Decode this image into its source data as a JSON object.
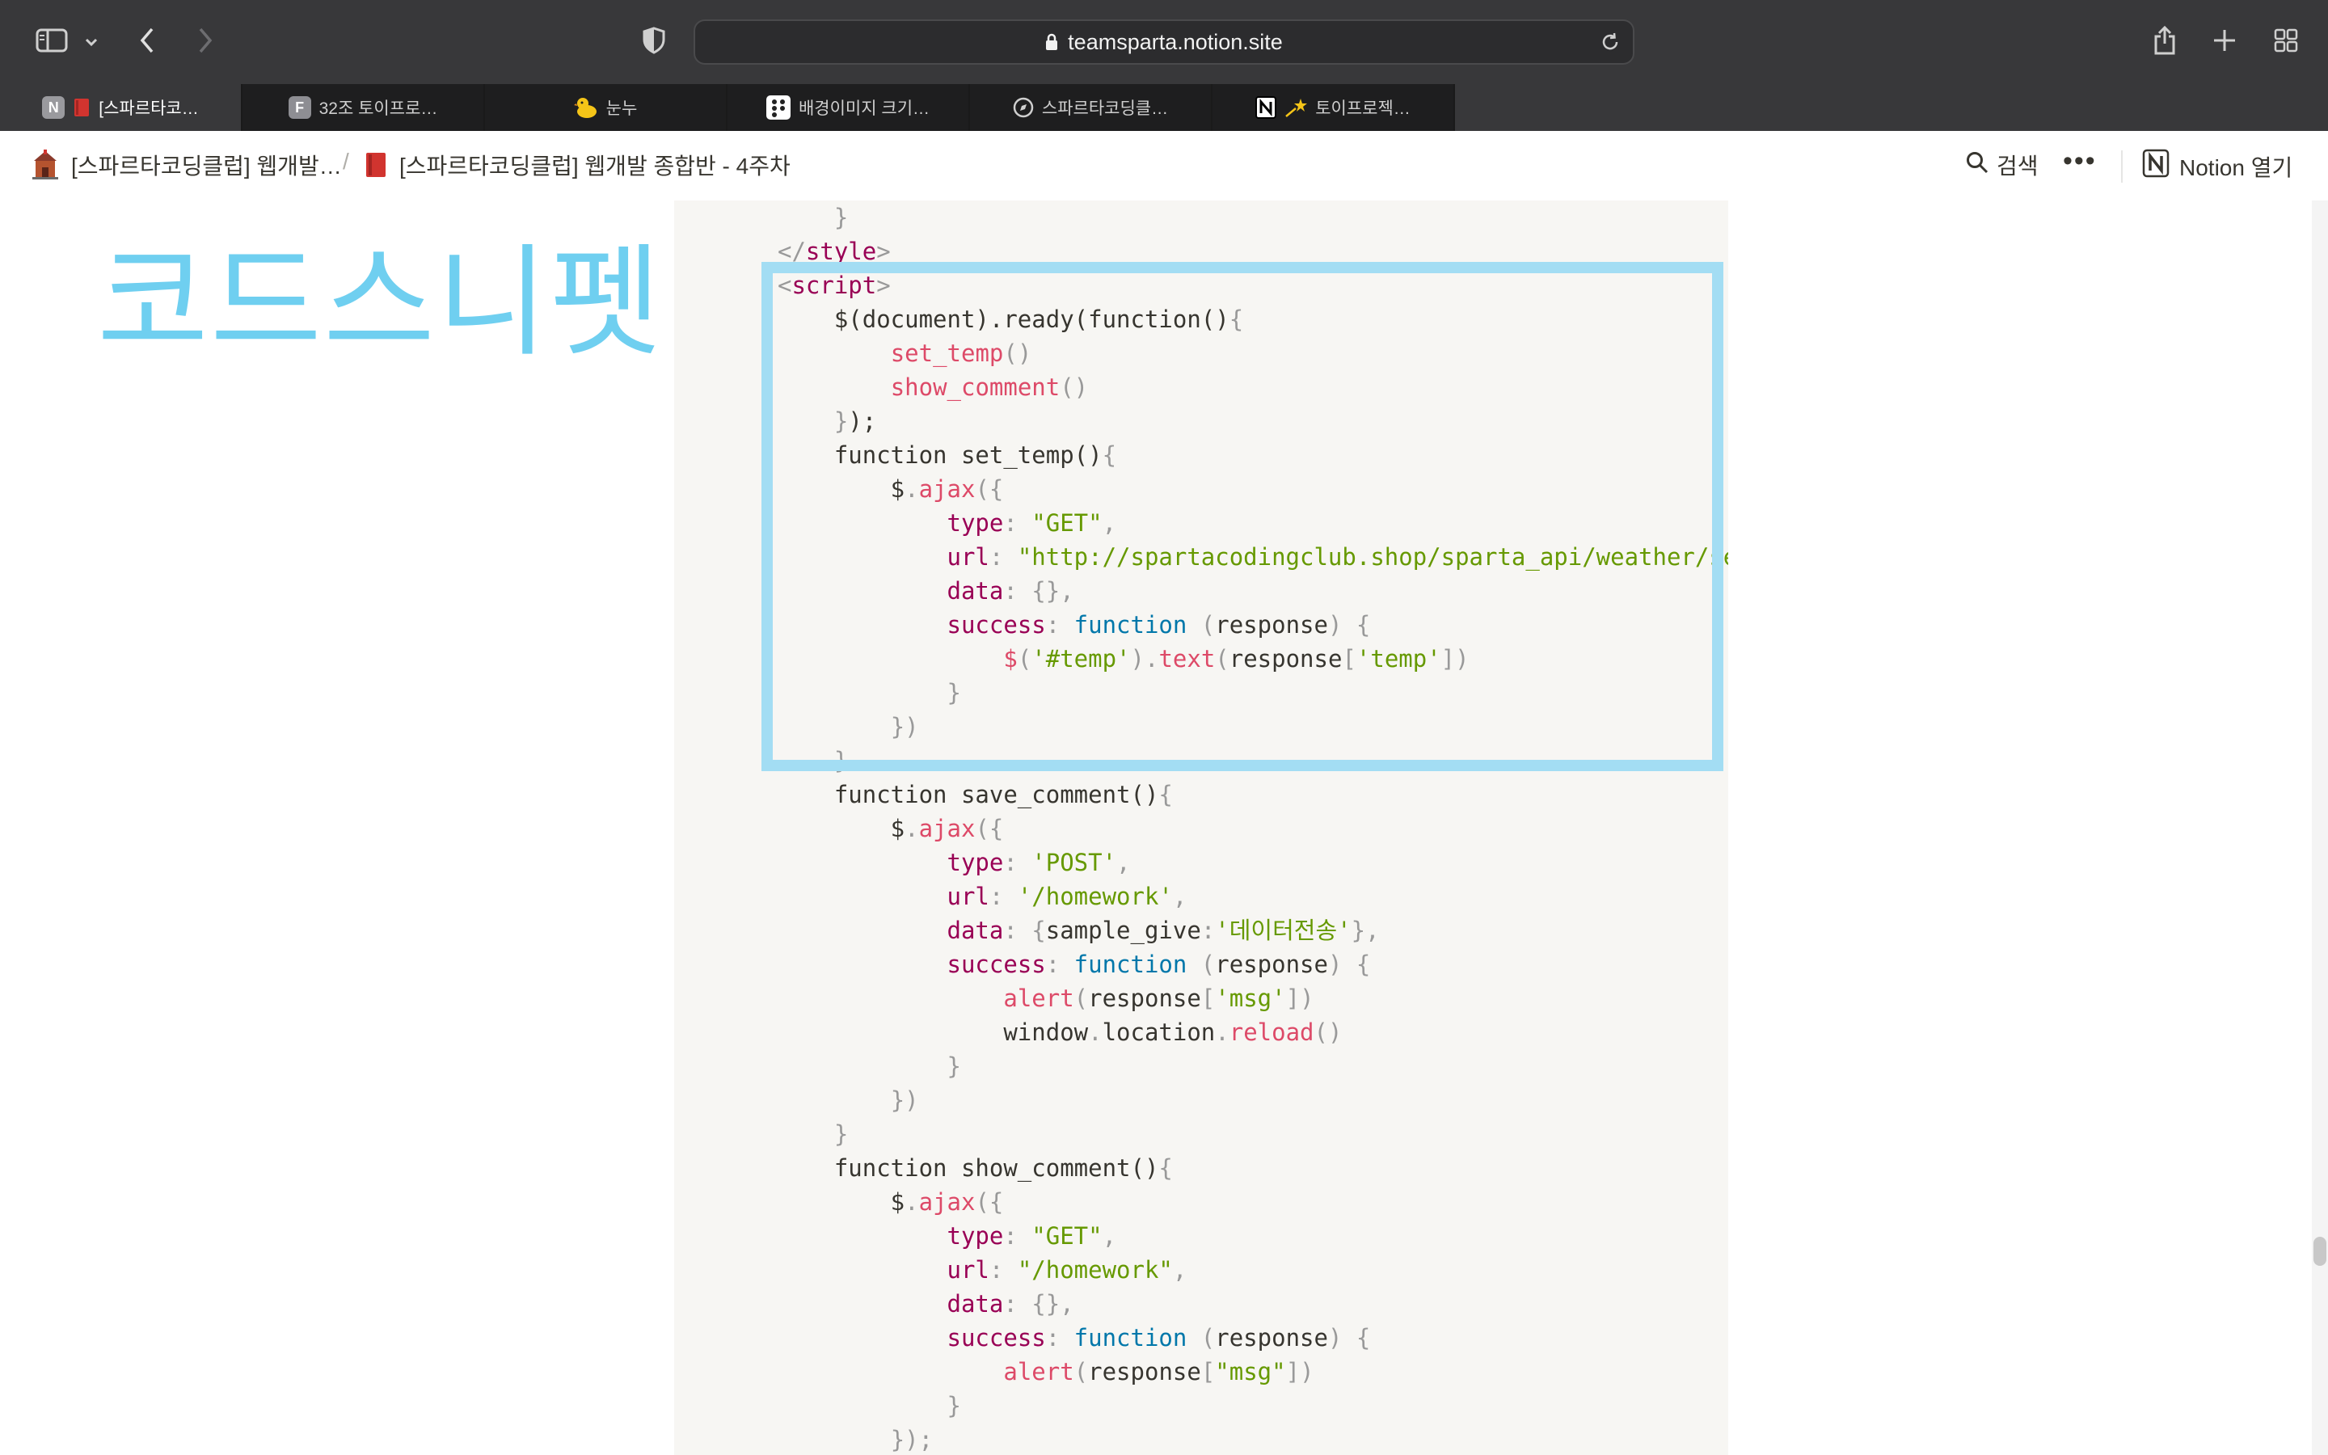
{
  "browser": {
    "url": "teamsparta.notion.site",
    "tabs": [
      {
        "label": "[스파르타코…",
        "fav": "N",
        "active": true
      },
      {
        "label": "32조 토이프로…",
        "fav": "F",
        "active": false
      },
      {
        "label": "눈누",
        "fav": "duck",
        "active": false
      },
      {
        "label": "배경이미지 크기…",
        "fav": "dots",
        "active": false
      },
      {
        "label": "스파르타코딩클…",
        "fav": "compass",
        "active": false
      },
      {
        "label": "토이프로젝…",
        "fav": "notion",
        "active": false
      }
    ]
  },
  "notion": {
    "breadcrumb_1": "[스파르타코딩클럽] 웹개발…",
    "breadcrumb_sep": "/",
    "breadcrumb_2": "[스파르타코딩클럽] 웹개발 종합반 - 4주차",
    "search_label": "검색",
    "more_label": "•••",
    "open_label": "Notion 열기"
  },
  "content": {
    "snippet_title": "코드스니펫"
  },
  "colors": {
    "highlight": "#a3ddf3",
    "title": "#6fcff0",
    "code_bg": "#f7f6f3"
  },
  "code_lines": [
    [
      [
        "    ",
        "plain"
      ],
      [
        "}",
        "punc"
      ]
    ],
    [
      [
        "</",
        "punc"
      ],
      [
        "style",
        "tag"
      ],
      [
        ">",
        "punc"
      ]
    ],
    [
      [
        "<",
        "punc"
      ],
      [
        "script",
        "tag"
      ],
      [
        ">",
        "punc"
      ]
    ],
    [
      [
        "    $(document).ready(function()",
        "plain"
      ],
      [
        "{",
        "punc"
      ]
    ],
    [
      [
        "        ",
        "plain"
      ],
      [
        "set_temp",
        "fn"
      ],
      [
        "()",
        "punc"
      ]
    ],
    [
      [
        "        ",
        "plain"
      ],
      [
        "show_comment",
        "fn"
      ],
      [
        "()",
        "punc"
      ]
    ],
    [
      [
        "    ",
        "plain"
      ],
      [
        "}",
        "punc"
      ],
      [
        ");",
        "plain"
      ]
    ],
    [
      [
        "    function set_temp()",
        "plain"
      ],
      [
        "{",
        "punc"
      ]
    ],
    [
      [
        "        $",
        "plain"
      ],
      [
        ".",
        "punc"
      ],
      [
        "ajax",
        "fn"
      ],
      [
        "({",
        "punc"
      ]
    ],
    [
      [
        "            ",
        "plain"
      ],
      [
        "type",
        "key"
      ],
      [
        ": ",
        "punc"
      ],
      [
        "\"GET\"",
        "str"
      ],
      [
        ",",
        "punc"
      ]
    ],
    [
      [
        "            ",
        "plain"
      ],
      [
        "url",
        "key"
      ],
      [
        ": ",
        "punc"
      ],
      [
        "\"http://spartacodingclub.shop/sparta_api/weather/seoul\"",
        "str"
      ],
      [
        ",",
        "punc"
      ]
    ],
    [
      [
        "            ",
        "plain"
      ],
      [
        "data",
        "key"
      ],
      [
        ": ",
        "punc"
      ],
      [
        "{},",
        "punc"
      ]
    ],
    [
      [
        "            ",
        "plain"
      ],
      [
        "success",
        "key"
      ],
      [
        ": ",
        "punc"
      ],
      [
        "function",
        "kw"
      ],
      [
        " (",
        "punc"
      ],
      [
        "response",
        "plain"
      ],
      [
        ") {",
        "punc"
      ]
    ],
    [
      [
        "                ",
        "plain"
      ],
      [
        "$",
        "fn"
      ],
      [
        "(",
        "punc"
      ],
      [
        "'#temp'",
        "str"
      ],
      [
        ").",
        "punc"
      ],
      [
        "text",
        "fn"
      ],
      [
        "(",
        "punc"
      ],
      [
        "response",
        "plain"
      ],
      [
        "[",
        "punc"
      ],
      [
        "'temp'",
        "str"
      ],
      [
        "])",
        "punc"
      ]
    ],
    [
      [
        "            ",
        "plain"
      ],
      [
        "}",
        "punc"
      ]
    ],
    [
      [
        "        ",
        "plain"
      ],
      [
        "})",
        "punc"
      ]
    ],
    [
      [
        "    ",
        "plain"
      ],
      [
        "}",
        "punc"
      ]
    ],
    [
      [
        "    function save_comment()",
        "plain"
      ],
      [
        "{",
        "punc"
      ]
    ],
    [
      [
        "        $",
        "plain"
      ],
      [
        ".",
        "punc"
      ],
      [
        "ajax",
        "fn"
      ],
      [
        "({",
        "punc"
      ]
    ],
    [
      [
        "            ",
        "plain"
      ],
      [
        "type",
        "key"
      ],
      [
        ": ",
        "punc"
      ],
      [
        "'POST'",
        "str"
      ],
      [
        ",",
        "punc"
      ]
    ],
    [
      [
        "            ",
        "plain"
      ],
      [
        "url",
        "key"
      ],
      [
        ": ",
        "punc"
      ],
      [
        "'/homework'",
        "str"
      ],
      [
        ",",
        "punc"
      ]
    ],
    [
      [
        "            ",
        "plain"
      ],
      [
        "data",
        "key"
      ],
      [
        ": ",
        "punc"
      ],
      [
        "{",
        "punc"
      ],
      [
        "sample_give",
        "plain"
      ],
      [
        ":",
        "punc"
      ],
      [
        "'데이터전송'",
        "str"
      ],
      [
        "},",
        "punc"
      ]
    ],
    [
      [
        "            ",
        "plain"
      ],
      [
        "success",
        "key"
      ],
      [
        ": ",
        "punc"
      ],
      [
        "function",
        "kw"
      ],
      [
        " (",
        "punc"
      ],
      [
        "response",
        "plain"
      ],
      [
        ") {",
        "punc"
      ]
    ],
    [
      [
        "                ",
        "plain"
      ],
      [
        "alert",
        "fn"
      ],
      [
        "(",
        "punc"
      ],
      [
        "response",
        "plain"
      ],
      [
        "[",
        "punc"
      ],
      [
        "'msg'",
        "str"
      ],
      [
        "])",
        "punc"
      ]
    ],
    [
      [
        "                window",
        "plain"
      ],
      [
        ".",
        "punc"
      ],
      [
        "location",
        "plain"
      ],
      [
        ".",
        "punc"
      ],
      [
        "reload",
        "fn"
      ],
      [
        "()",
        "punc"
      ]
    ],
    [
      [
        "            ",
        "plain"
      ],
      [
        "}",
        "punc"
      ]
    ],
    [
      [
        "        ",
        "plain"
      ],
      [
        "})",
        "punc"
      ]
    ],
    [
      [
        "    ",
        "plain"
      ],
      [
        "}",
        "punc"
      ]
    ],
    [
      [
        "    function show_comment()",
        "plain"
      ],
      [
        "{",
        "punc"
      ]
    ],
    [
      [
        "        $",
        "plain"
      ],
      [
        ".",
        "punc"
      ],
      [
        "ajax",
        "fn"
      ],
      [
        "({",
        "punc"
      ]
    ],
    [
      [
        "            ",
        "plain"
      ],
      [
        "type",
        "key"
      ],
      [
        ": ",
        "punc"
      ],
      [
        "\"GET\"",
        "str"
      ],
      [
        ",",
        "punc"
      ]
    ],
    [
      [
        "            ",
        "plain"
      ],
      [
        "url",
        "key"
      ],
      [
        ": ",
        "punc"
      ],
      [
        "\"/homework\"",
        "str"
      ],
      [
        ",",
        "punc"
      ]
    ],
    [
      [
        "            ",
        "plain"
      ],
      [
        "data",
        "key"
      ],
      [
        ": ",
        "punc"
      ],
      [
        "{},",
        "punc"
      ]
    ],
    [
      [
        "            ",
        "plain"
      ],
      [
        "success",
        "key"
      ],
      [
        ": ",
        "punc"
      ],
      [
        "function",
        "kw"
      ],
      [
        " (",
        "punc"
      ],
      [
        "response",
        "plain"
      ],
      [
        ") {",
        "punc"
      ]
    ],
    [
      [
        "                ",
        "plain"
      ],
      [
        "alert",
        "fn"
      ],
      [
        "(",
        "punc"
      ],
      [
        "response",
        "plain"
      ],
      [
        "[",
        "punc"
      ],
      [
        "\"msg\"",
        "str"
      ],
      [
        "])",
        "punc"
      ]
    ],
    [
      [
        "            ",
        "plain"
      ],
      [
        "}",
        "punc"
      ]
    ],
    [
      [
        "        ",
        "plain"
      ],
      [
        "});",
        "punc"
      ]
    ]
  ]
}
